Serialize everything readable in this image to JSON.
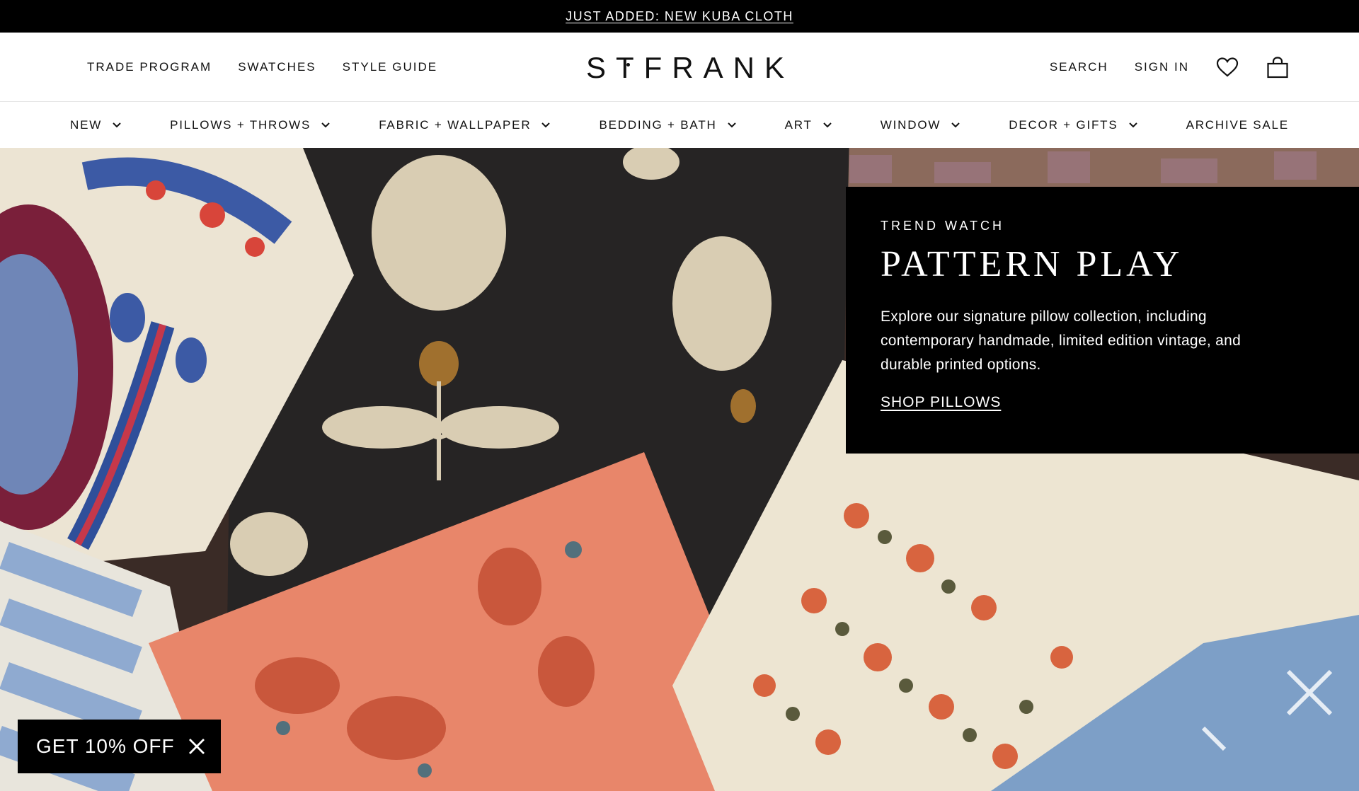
{
  "announcement": {
    "text": "JUST ADDED: NEW KUBA CLOTH"
  },
  "header": {
    "left_links": [
      "TRADE PROGRAM",
      "SWATCHES",
      "STYLE GUIDE"
    ],
    "logo_text": "STFRANK",
    "right_links": [
      "SEARCH",
      "SIGN IN"
    ],
    "icons": [
      "heart-icon",
      "shopping-bag-icon"
    ]
  },
  "nav": {
    "items": [
      {
        "label": "NEW",
        "has_dropdown": true
      },
      {
        "label": "PILLOWS + THROWS",
        "has_dropdown": true
      },
      {
        "label": "FABRIC + WALLPAPER",
        "has_dropdown": true
      },
      {
        "label": "BEDDING + BATH",
        "has_dropdown": true
      },
      {
        "label": "ART",
        "has_dropdown": true
      },
      {
        "label": "WINDOW",
        "has_dropdown": true
      },
      {
        "label": "DECOR + GIFTS",
        "has_dropdown": true
      },
      {
        "label": "ARCHIVE SALE",
        "has_dropdown": false
      }
    ]
  },
  "hero": {
    "eyebrow": "TREND WATCH",
    "headline": "PATTERN PLAY",
    "description": "Explore our signature pillow collection, including contemporary handmade, limited edition vintage, and durable printed options.",
    "cta": "SHOP PILLOWS"
  },
  "promo": {
    "label": "GET 10% OFF"
  },
  "colors": {
    "black": "#000000",
    "white": "#ffffff",
    "terracotta": "#e8866a",
    "indigo": "#3c5aa5",
    "cream": "#ece4d3",
    "charcoal": "#262424"
  }
}
